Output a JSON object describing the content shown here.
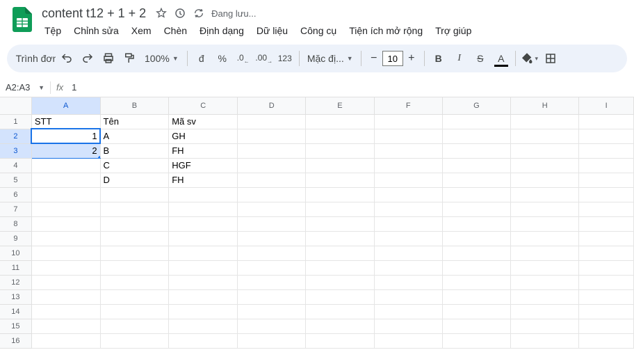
{
  "doc": {
    "title": "content t12 + 1 + 2",
    "saving_prefix": "Đang lưu..."
  },
  "menu": {
    "file": "Tệp",
    "edit": "Chỉnh sửa",
    "view": "Xem",
    "insert": "Chèn",
    "format": "Định dạng",
    "data": "Dữ liệu",
    "tools": "Công cụ",
    "ext": "Tiện ích mở rộng",
    "help": "Trợ giúp"
  },
  "toolbar": {
    "search": "Trình đơn",
    "zoom": "100%",
    "currency": "đ",
    "percent": "%",
    "dec_dec": ".0",
    "dec_inc": ".00",
    "num123": "123",
    "font": "Mặc đị...",
    "size": "10",
    "bold": "B",
    "italic": "I",
    "strike": "S",
    "text_color": "A"
  },
  "formula": {
    "namebox": "A2:A3",
    "fx": "fx",
    "value": "1"
  },
  "columns": [
    "A",
    "B",
    "C",
    "D",
    "E",
    "F",
    "G",
    "H",
    "I"
  ],
  "rows": [
    "1",
    "2",
    "3",
    "4",
    "5",
    "6",
    "7",
    "8",
    "9",
    "10",
    "11",
    "12",
    "13",
    "14",
    "15",
    "16"
  ],
  "cells": {
    "A1": "STT",
    "B1": "Tên",
    "C1": "Mã sv",
    "A2": "1",
    "B2": "A",
    "C2": "GH",
    "A3": "2",
    "B3": "B",
    "C3": "FH",
    "B4": "C",
    "C4": "HGF",
    "B5": "D",
    "C5": "FH"
  }
}
